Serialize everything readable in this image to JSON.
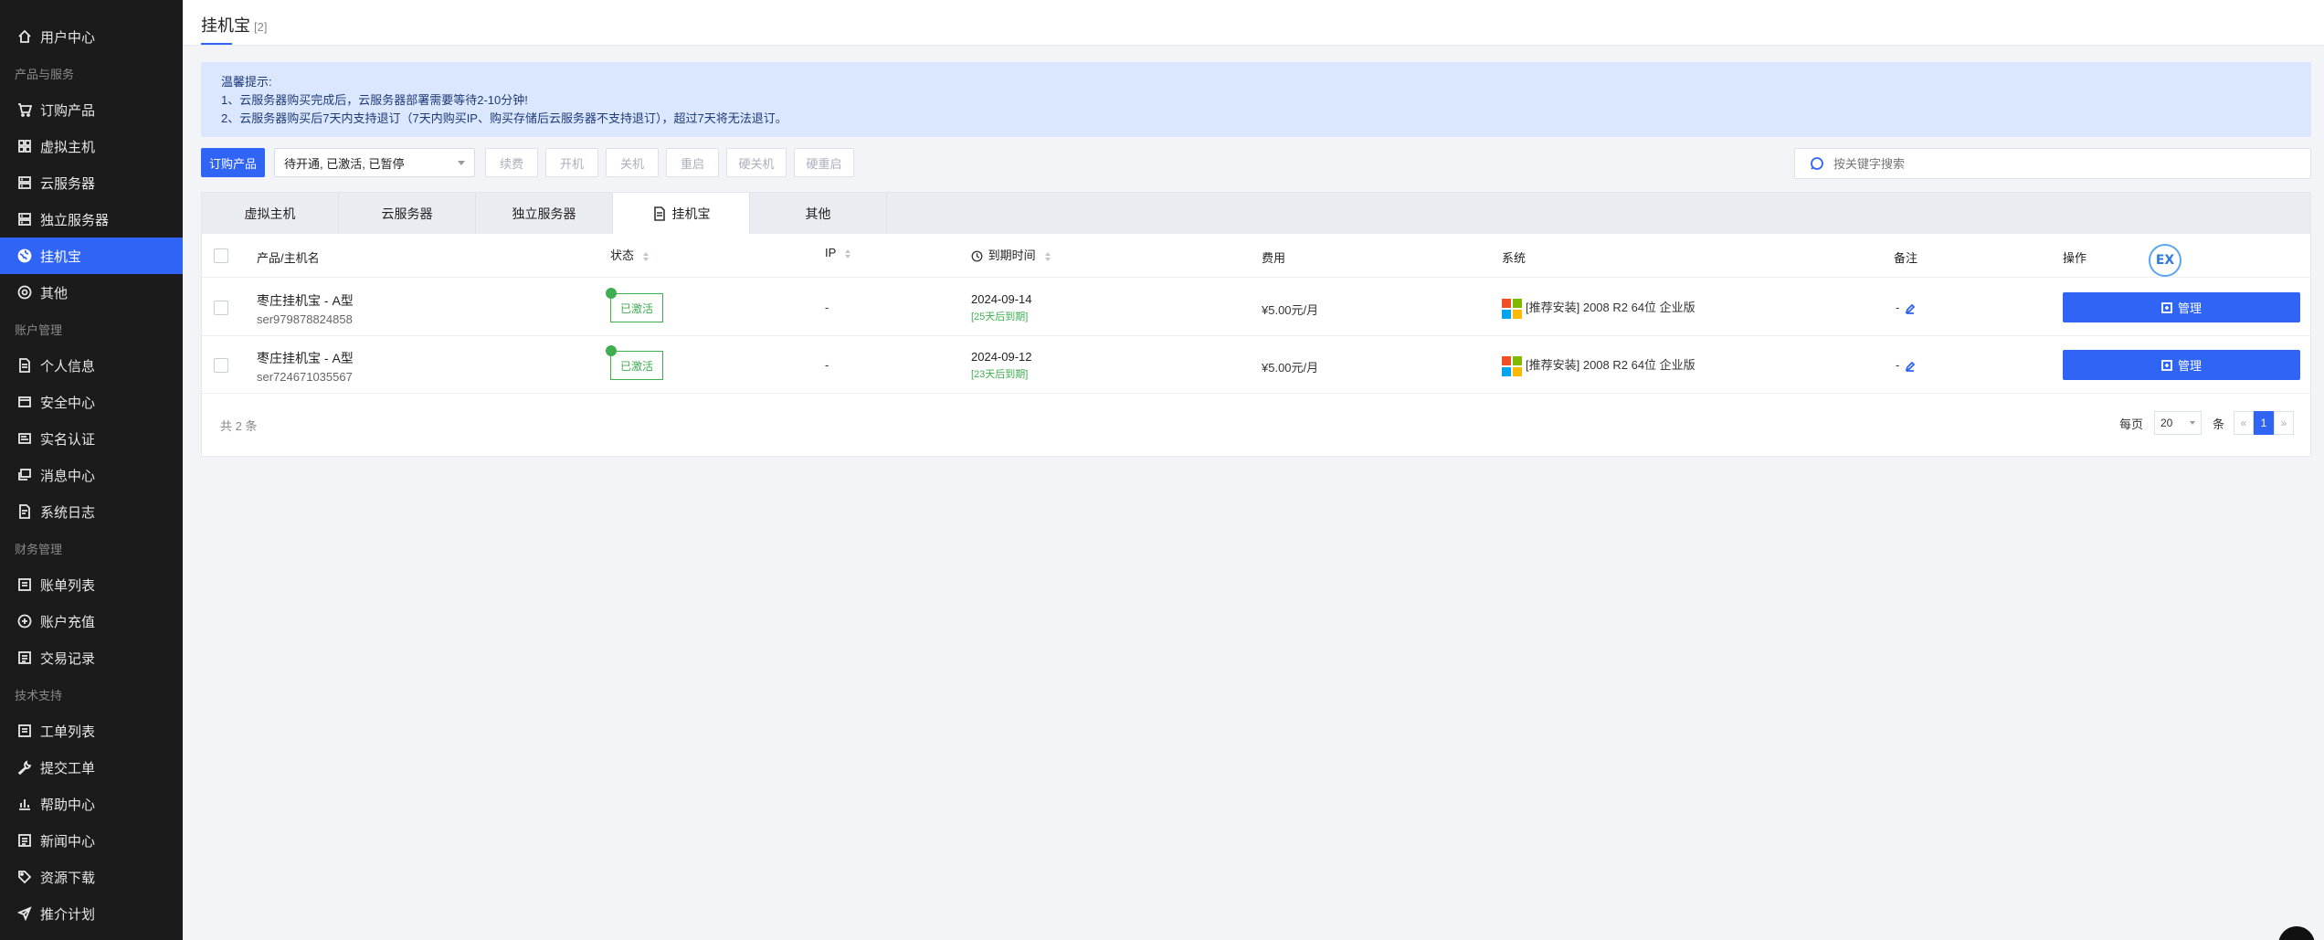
{
  "sidebar": {
    "items": [
      {
        "type": "item",
        "label": "用户中心",
        "icon": "home-icon",
        "active": false
      },
      {
        "type": "group",
        "label": "产品与服务"
      },
      {
        "type": "item",
        "label": "订购产品",
        "icon": "cart-icon",
        "active": false
      },
      {
        "type": "item",
        "label": "虚拟主机",
        "icon": "grid-icon",
        "active": false
      },
      {
        "type": "item",
        "label": "云服务器",
        "icon": "server-icon",
        "active": false
      },
      {
        "type": "item",
        "label": "独立服务器",
        "icon": "server-icon",
        "active": false
      },
      {
        "type": "item",
        "label": "挂机宝",
        "icon": "globe-icon",
        "active": true
      },
      {
        "type": "item",
        "label": "其他",
        "icon": "target-icon",
        "active": false
      },
      {
        "type": "group",
        "label": "账户管理"
      },
      {
        "type": "item",
        "label": "个人信息",
        "icon": "document-icon",
        "active": false
      },
      {
        "type": "item",
        "label": "安全中心",
        "icon": "shield-icon",
        "active": false
      },
      {
        "type": "item",
        "label": "实名认证",
        "icon": "id-card-icon",
        "active": false
      },
      {
        "type": "item",
        "label": "消息中心",
        "icon": "message-icon",
        "active": false
      },
      {
        "type": "item",
        "label": "系统日志",
        "icon": "log-icon",
        "active": false
      },
      {
        "type": "group",
        "label": "财务管理"
      },
      {
        "type": "item",
        "label": "账单列表",
        "icon": "list-icon",
        "active": false
      },
      {
        "type": "item",
        "label": "账户充值",
        "icon": "plus-circle-icon",
        "active": false
      },
      {
        "type": "item",
        "label": "交易记录",
        "icon": "receipt-icon",
        "active": false
      },
      {
        "type": "group",
        "label": "技术支持"
      },
      {
        "type": "item",
        "label": "工单列表",
        "icon": "ticket-icon",
        "active": false
      },
      {
        "type": "item",
        "label": "提交工单",
        "icon": "wrench-icon",
        "active": false
      },
      {
        "type": "item",
        "label": "帮助中心",
        "icon": "chart-icon",
        "active": false
      },
      {
        "type": "item",
        "label": "新闻中心",
        "icon": "news-icon",
        "active": false
      },
      {
        "type": "item",
        "label": "资源下载",
        "icon": "tag-icon",
        "active": false
      },
      {
        "type": "item",
        "label": "推介计划",
        "icon": "send-icon",
        "active": false
      }
    ]
  },
  "header": {
    "title": "挂机宝",
    "count": "[2]"
  },
  "notice": {
    "title": "温馨提示:",
    "line1": "1、云服务器购买完成后，云服务器部署需要等待2-10分钟!",
    "line2": "2、云服务器购买后7天内支持退订（7天内购买IP、购买存储后云服务器不支持退订），超过7天将无法退订。"
  },
  "toolbar": {
    "order_label": "订购产品",
    "status_filter": "待开通, 已激活, 已暂停",
    "actions": [
      "续费",
      "开机",
      "关机",
      "重启",
      "硬关机",
      "硬重启"
    ],
    "search_placeholder": "按关键字搜索"
  },
  "tabs": [
    {
      "label": "虚拟主机",
      "active": false
    },
    {
      "label": "云服务器",
      "active": false
    },
    {
      "label": "独立服务器",
      "active": false
    },
    {
      "label": "挂机宝",
      "active": true
    },
    {
      "label": "其他",
      "active": false
    }
  ],
  "table": {
    "columns": {
      "product": "产品/主机名",
      "status": "状态",
      "ip": "IP",
      "expire": "到期时间",
      "fee": "费用",
      "system": "系统",
      "note": "备注",
      "action": "操作"
    },
    "rows": [
      {
        "name": "枣庄挂机宝 - A型",
        "host": "ser979878824858",
        "status": "已激活",
        "ip": "-",
        "expire_date": "2024-09-14",
        "expire_left": "[25天后到期]",
        "fee": "¥5.00元/月",
        "system": "[推荐安装] 2008 R2 64位 企业版",
        "note": "-",
        "action": "管理"
      },
      {
        "name": "枣庄挂机宝 - A型",
        "host": "ser724671035567",
        "status": "已激活",
        "ip": "-",
        "expire_date": "2024-09-12",
        "expire_left": "[23天后到期]",
        "fee": "¥5.00元/月",
        "system": "[推荐安装] 2008 R2 64位 企业版",
        "note": "-",
        "action": "管理"
      }
    ]
  },
  "pagination": {
    "total": "共 2 条",
    "per_page_label": "每页",
    "per_page": "20",
    "unit": "条",
    "prev": "«",
    "current": "1",
    "next": "»"
  },
  "extension_badge": "EX",
  "colors": {
    "primary": "#2f64f5",
    "success": "#3fae4f",
    "sidebar_bg": "#1b1b1b",
    "notice_bg": "#dbe7fe"
  }
}
